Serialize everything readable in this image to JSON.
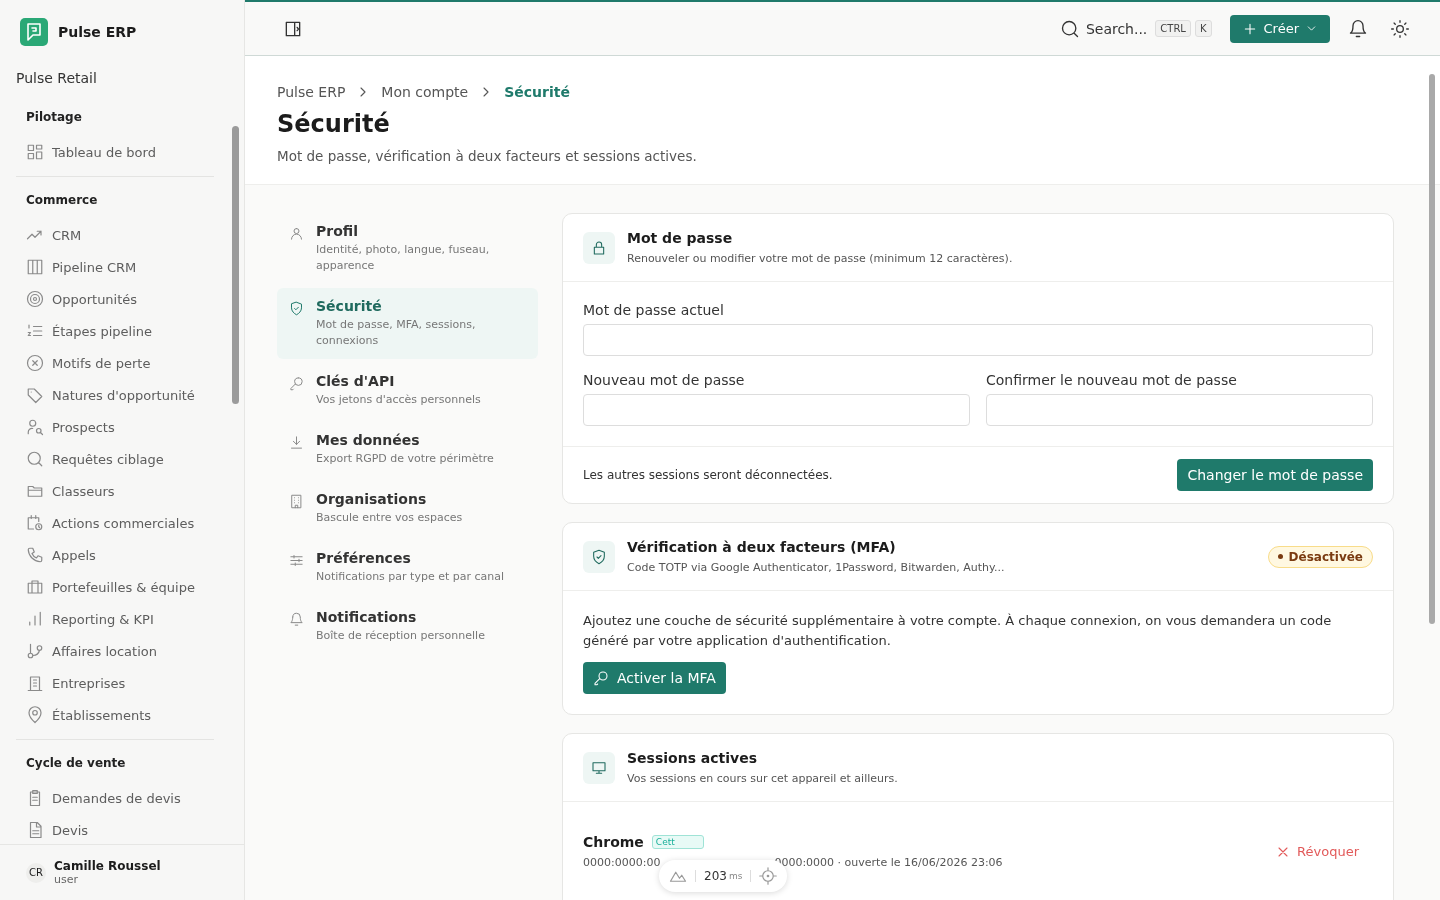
{
  "app": {
    "name": "Pulse ERP",
    "workspace": "Pulse Retail"
  },
  "sidebar": {
    "sections": [
      {
        "title": "Pilotage",
        "items": [
          {
            "label": "Tableau de bord"
          }
        ]
      },
      {
        "title": "Commerce",
        "items": [
          {
            "label": "CRM"
          },
          {
            "label": "Pipeline CRM"
          },
          {
            "label": "Opportunités"
          },
          {
            "label": "Étapes pipeline"
          },
          {
            "label": "Motifs de perte"
          },
          {
            "label": "Natures d'opportunité"
          },
          {
            "label": "Prospects"
          },
          {
            "label": "Requêtes ciblage"
          },
          {
            "label": "Classeurs"
          },
          {
            "label": "Actions commerciales"
          },
          {
            "label": "Appels"
          },
          {
            "label": "Portefeuilles & équipe"
          },
          {
            "label": "Reporting & KPI"
          },
          {
            "label": "Affaires location"
          },
          {
            "label": "Entreprises"
          },
          {
            "label": "Établissements"
          }
        ]
      },
      {
        "title": "Cycle de vente",
        "items": [
          {
            "label": "Demandes de devis"
          },
          {
            "label": "Devis"
          }
        ]
      }
    ],
    "user": {
      "initials": "CR",
      "name": "Camille Roussel",
      "role": "user"
    }
  },
  "topbar": {
    "search": "Search...",
    "keys": [
      "CTRL",
      "K"
    ],
    "create": "Créer"
  },
  "breadcrumb": [
    {
      "label": "Pulse ERP",
      "current": false
    },
    {
      "label": "Mon compte",
      "current": false
    },
    {
      "label": "Sécurité",
      "current": true
    }
  ],
  "page": {
    "title": "Sécurité",
    "subtitle": "Mot de passe, vérification à deux facteurs et sessions actives."
  },
  "settings_nav": [
    {
      "title": "Profil",
      "desc": "Identité, photo, langue, fuseau, apparence",
      "selected": false
    },
    {
      "title": "Sécurité",
      "desc": "Mot de passe, MFA, sessions, connexions",
      "selected": true
    },
    {
      "title": "Clés d'API",
      "desc": "Vos jetons d'accès personnels",
      "selected": false
    },
    {
      "title": "Mes données",
      "desc": "Export RGPD de votre périmètre",
      "selected": false
    },
    {
      "title": "Organisations",
      "desc": "Bascule entre vos espaces",
      "selected": false
    },
    {
      "title": "Préférences",
      "desc": "Notifications par type et par canal",
      "selected": false
    },
    {
      "title": "Notifications",
      "desc": "Boîte de réception personnelle",
      "selected": false
    }
  ],
  "password": {
    "title": "Mot de passe",
    "desc": "Renouveler ou modifier votre mot de passe (minimum 12 caractères).",
    "current_label": "Mot de passe actuel",
    "new_label": "Nouveau mot de passe",
    "confirm_label": "Confirmer le nouveau mot de passe",
    "note": "Les autres sessions seront déconnectées.",
    "button": "Changer le mot de passe"
  },
  "mfa": {
    "title": "Vérification à deux facteurs (MFA)",
    "desc": "Code TOTP via Google Authenticator, 1Password, Bitwarden, Authy...",
    "status": "Désactivée",
    "enabled": false,
    "text": "Ajoutez une couche de sécurité supplémentaire à votre compte. À chaque connexion, on vous demandera un code généré par votre application d'authentification.",
    "button": "Activer la MFA"
  },
  "sessions": {
    "title": "Sessions actives",
    "desc": "Vos sessions en cours sur cet appareil et ailleurs.",
    "items": [
      {
        "browser": "Chrome",
        "badge": "Cett",
        "meta_start": "0000:0000:00",
        "meta_end": "0000:0000 · ouverte le 16/06/2026 23:06",
        "revoke": "Révoquer"
      }
    ]
  },
  "dev_overlay": {
    "value": "203",
    "unit": "ms"
  }
}
